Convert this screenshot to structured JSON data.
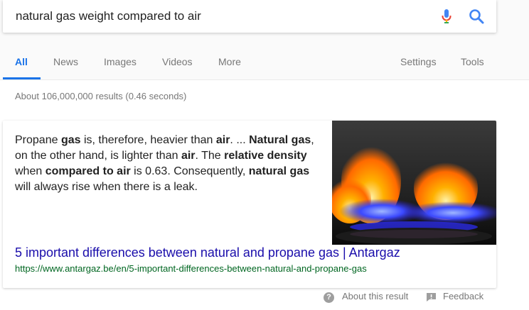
{
  "search": {
    "query": "natural gas weight compared to air"
  },
  "tabs": [
    {
      "label": "All",
      "active": true
    },
    {
      "label": "News"
    },
    {
      "label": "Images"
    },
    {
      "label": "Videos"
    },
    {
      "label": "More"
    }
  ],
  "tools": {
    "settings": "Settings",
    "tools": "Tools"
  },
  "result_stats": "About 106,000,000 results (0.46 seconds)",
  "featured_snippet": {
    "segments": [
      {
        "text": "Propane ",
        "bold": false
      },
      {
        "text": "gas",
        "bold": true
      },
      {
        "text": " is, therefore, heavier than ",
        "bold": false
      },
      {
        "text": "air",
        "bold": true
      },
      {
        "text": ". ... ",
        "bold": false
      },
      {
        "text": "Natural gas",
        "bold": true
      },
      {
        "text": ", on the other hand, is lighter than ",
        "bold": false
      },
      {
        "text": "air",
        "bold": true
      },
      {
        "text": ". The ",
        "bold": false
      },
      {
        "text": "relative density",
        "bold": true
      },
      {
        "text": " when ",
        "bold": false
      },
      {
        "text": "compared to air",
        "bold": true
      },
      {
        "text": " is 0.63. Consequently, ",
        "bold": false
      },
      {
        "text": "natural gas",
        "bold": true
      },
      {
        "text": " will always rise when there is a leak.",
        "bold": false
      }
    ],
    "title": "5 important differences between natural and propane gas | Antargaz",
    "url": "https://www.antargaz.be/en/5-important-differences-between-natural-and-propane-gas"
  },
  "footer": {
    "about": "About this result",
    "feedback": "Feedback"
  },
  "colors": {
    "accent": "#1a73e8",
    "link": "#1a0dab",
    "url": "#006621"
  }
}
